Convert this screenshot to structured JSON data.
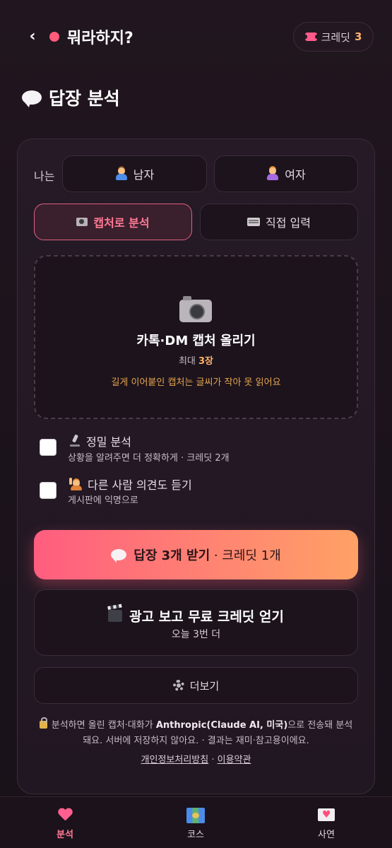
{
  "header": {
    "back_glyph": "‹",
    "app_title": "뭐라하지?",
    "credit_label": "크레딧",
    "credit_count": "3",
    "accent_color": "#ff5b7a"
  },
  "page": {
    "title": "답장 분석",
    "title_icon": "speech-bubble-icon"
  },
  "gender": {
    "label": "나는",
    "male": "남자",
    "female": "여자",
    "selected": ""
  },
  "mode": {
    "capture": "캡처로 분석",
    "manual": "직접 입력",
    "selected": "capture"
  },
  "upload": {
    "title": "카톡·DM 캡처 올리기",
    "max_prefix": "최대 ",
    "max_value": "3장",
    "warning": "길게 이어붙인 캡처는 글씨가 작아 못 읽어요"
  },
  "options": [
    {
      "title": "정밀 분석",
      "subtitle": "상황을 알려주면 더 정확하게 · 크레딧 2개",
      "checked": false,
      "icon": "microscope-icon"
    },
    {
      "title": "다른 사람 의견도 듣기",
      "subtitle": "게시판에 익명으로",
      "checked": false,
      "icon": "raising-hand-icon"
    }
  ],
  "cta": {
    "main": "답장 3개 받기",
    "suffix": " · 크레딧 1개"
  },
  "ad": {
    "title": "광고 보고 무료 크레딧 얻기",
    "subtitle": "오늘 3번 더"
  },
  "more": {
    "label": "더보기"
  },
  "notice": {
    "prefix": "분석하면 올린 캡처·대화가 ",
    "provider": "Anthropic(Claude AI, 미국)",
    "suffix": "으로 전송돼 분석돼요. 서버에 저장하지 않아요. · 결과는 재미·참고용이에요.",
    "privacy_link": "개인정보처리방침",
    "separator": " · ",
    "terms_link": "이용약관"
  },
  "tabbar": {
    "items": [
      {
        "label": "분석",
        "icon": "heart-icon",
        "active": true
      },
      {
        "label": "코스",
        "icon": "map-icon",
        "active": false
      },
      {
        "label": "사연",
        "icon": "love-letter-icon",
        "active": false
      }
    ]
  }
}
